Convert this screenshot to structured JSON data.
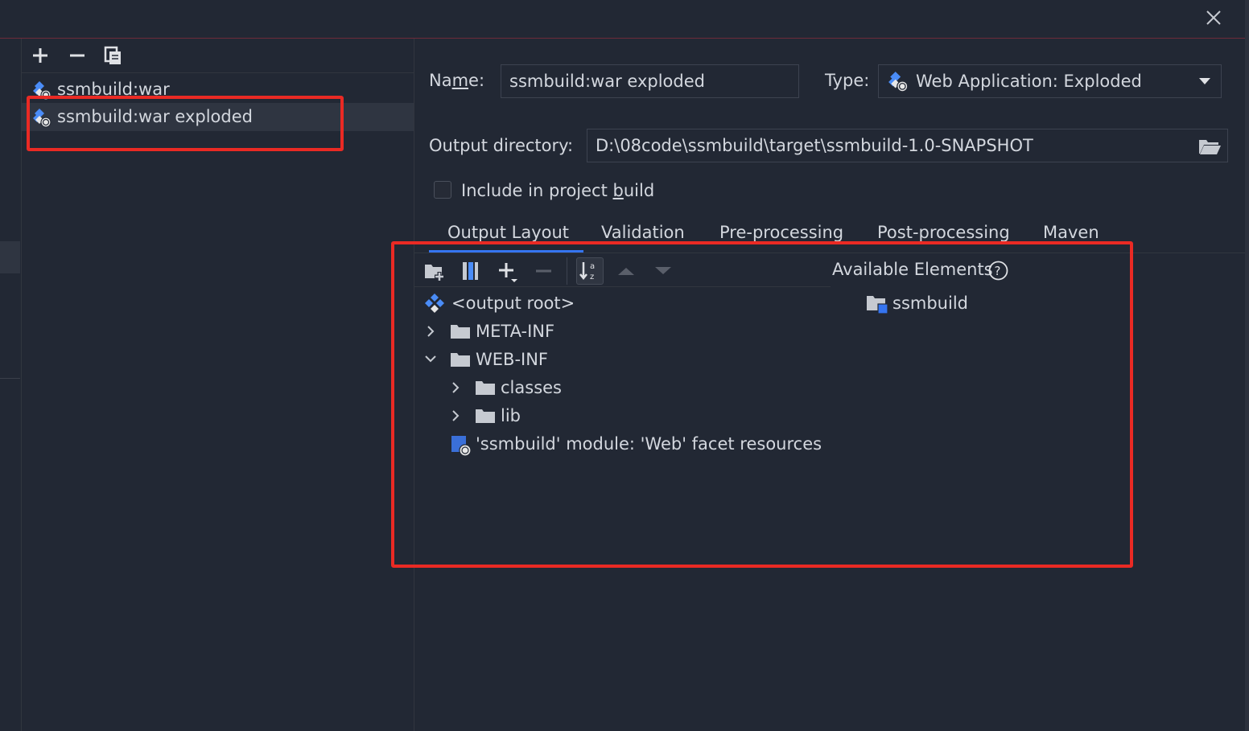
{
  "window": {
    "close_icon": "close-icon"
  },
  "left_panel": {
    "toolbar": [
      "add-icon",
      "remove-icon",
      "copy-icon"
    ],
    "artifacts": [
      {
        "label": "ssmbuild:war",
        "icon": "war-artifact-icon",
        "selected": false
      },
      {
        "label": "ssmbuild:war exploded",
        "icon": "war-exploded-artifact-icon",
        "selected": true
      }
    ]
  },
  "form": {
    "name_label_pre": "Na",
    "name_label_mnemonic": "m",
    "name_label_post": "e:",
    "name_value": "ssmbuild:war exploded",
    "type_label": "Type:",
    "type_value": "Web Application: Exploded",
    "output_dir_label": "Output directory:",
    "output_dir_value": "D:\\08code\\ssmbuild\\target\\ssmbuild-1.0-SNAPSHOT",
    "include_label_pre": "Include in project ",
    "include_label_mnemonic": "b",
    "include_label_post": "uild",
    "include_checked": false
  },
  "tabs": [
    "Output Layout",
    "Validation",
    "Pre-processing",
    "Post-processing",
    "Maven"
  ],
  "active_tab": "Output Layout",
  "layout": {
    "toolbar": [
      "new-directory-icon",
      "columns-icon",
      "add-copy-icon",
      "remove-icon",
      "sort-alpha-icon",
      "move-up-icon",
      "move-down-icon"
    ],
    "tree": [
      {
        "label": "<output root>",
        "icon": "output-root-icon",
        "expand": "none",
        "level": 0
      },
      {
        "label": "META-INF",
        "icon": "folder-icon",
        "expand": "collapsed",
        "level": 0
      },
      {
        "label": "WEB-INF",
        "icon": "folder-icon",
        "expand": "expanded",
        "level": 0
      },
      {
        "label": "classes",
        "icon": "folder-icon",
        "expand": "collapsed",
        "level": 1
      },
      {
        "label": "lib",
        "icon": "folder-icon",
        "expand": "collapsed",
        "level": 1
      },
      {
        "label": "'ssmbuild' module: 'Web' facet resources",
        "icon": "web-facet-icon",
        "expand": "none",
        "level": 0
      }
    ],
    "available_title": "Available Elements",
    "available_items": [
      {
        "label": "ssmbuild",
        "icon": "module-folder-icon"
      }
    ]
  },
  "colors": {
    "background": "#222834",
    "selection": "#2f3541",
    "annotation_red": "#ea2a24",
    "accent_blue": "#3574f0"
  }
}
